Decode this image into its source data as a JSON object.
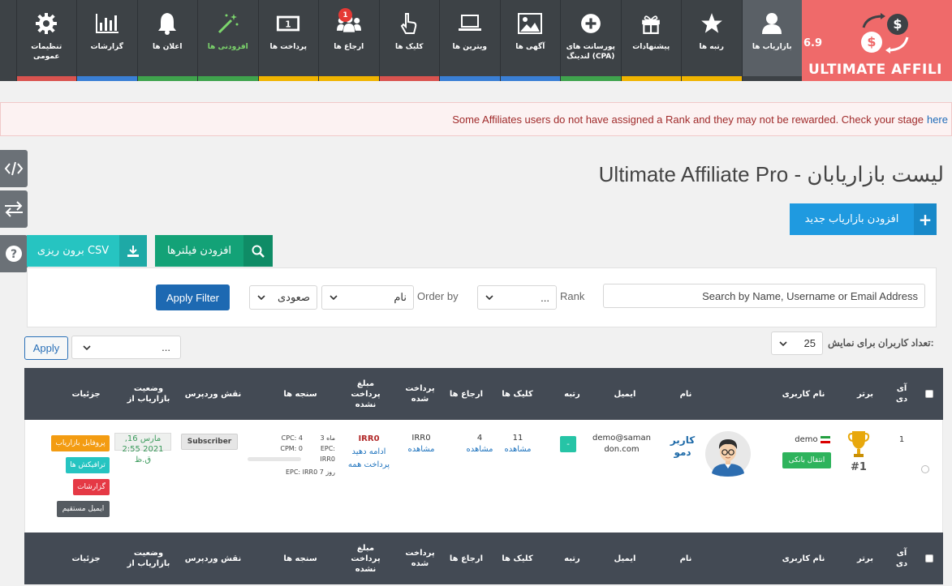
{
  "brand": {
    "version": "6.9",
    "name": "ULTIMATE AFFILI"
  },
  "nav": [
    {
      "label": "بازاریاب ها",
      "icon": "user-icon",
      "active": true
    },
    {
      "label": "رتبه ها",
      "icon": "star-icon"
    },
    {
      "label": "پیشنهادات",
      "icon": "gift-icon"
    },
    {
      "label": "پورسانت های لندینگ (CPA)",
      "icon": "plus-circle-icon"
    },
    {
      "label": "آگهی ها",
      "icon": "image-icon"
    },
    {
      "label": "ویترین ها",
      "icon": "laptop-icon"
    },
    {
      "label": "کلیک ها",
      "icon": "pointer-hand-icon"
    },
    {
      "label": "ارجاع ها",
      "icon": "users-group-icon",
      "badge": "1"
    },
    {
      "label": "پرداخت ها",
      "icon": "money-icon"
    },
    {
      "label": "افزودنی ها",
      "icon": "magic-wand-icon",
      "highlight": "#7cd66c"
    },
    {
      "label": "اعلان ها",
      "icon": "bell-icon"
    },
    {
      "label": "گزارشات",
      "icon": "bar-chart-icon"
    },
    {
      "label": "تنظیمات عمومی",
      "icon": "gear-icon"
    }
  ],
  "notice": {
    "text": "Some Affiliates users do not have assigned a Rank and they may not be rewarded. Check your stage",
    "link": "here"
  },
  "page_title": "Ultimate Affiliate Pro - لیست بازاریابان",
  "buttons": {
    "add_affiliate": "افزودن بازاریاب جدید",
    "add_filters": "افزودن فیلترها",
    "csv_export": "برون ریزی CSV",
    "apply_filter": "Apply Filter",
    "apply": "Apply"
  },
  "filters": {
    "search_placeholder": "Search by Name, Username or Email Address",
    "rank_label": "Rank",
    "rank_value": "...",
    "order_by_label": "Order by",
    "order_by_value": "نام",
    "order_value": "صعودی",
    "bulk_value": "...",
    "per_page_label": "تعداد کاربران برای نمایش:",
    "per_page_value": "25"
  },
  "table": {
    "headers": [
      "آی دی",
      "برتر",
      "نام کاربری",
      "نام",
      "ایمیل",
      "رتبه",
      "کلیک ها",
      "ارجاع ها",
      "پرداخت شده",
      "مبلغ پرداخت نشده",
      "سنجه ها",
      "نقش وردپرس",
      "وضعیت بازاریاب از",
      "جزئیات"
    ],
    "rows": [
      {
        "id": "1",
        "top_rank": "#1",
        "username": "demo",
        "switch_label": "انتقال بانکی",
        "name": "کاربر دمو",
        "email": "demo@samandon.com",
        "rank": "-",
        "clicks": "11",
        "clicks_link": "مشاهده",
        "referrals": "4",
        "referrals_link": "مشاهده",
        "paid": "IRR0",
        "paid_link": "مشاهده",
        "unpaid": "IRR0",
        "unpaid_link_1": "ادامه دهید",
        "unpaid_link_2": "پرداخت همه",
        "metrics_left": [
          "CPC: 4",
          "CPM: 0",
          "EPC: IRR0"
        ],
        "metrics_right": [
          "3 ماه",
          "EPC:",
          "IRR0",
          "7 روز"
        ],
        "wp_role": "Subscriber",
        "since": "مارس 16, 2021 2:55 ق.ظ",
        "details": [
          "پروفایل بازاریاب",
          "ترافیکش ها",
          "گزارشات",
          "ایمیل مستقیم"
        ]
      }
    ]
  },
  "colors": {
    "nav_bg": "#3d4246",
    "brand_bg": "#ef6a6a",
    "header_bg": "#434a54",
    "stripes": [
      "#d9534f",
      "#f0b400",
      "#3fa34d",
      "#3a7fd5"
    ]
  }
}
